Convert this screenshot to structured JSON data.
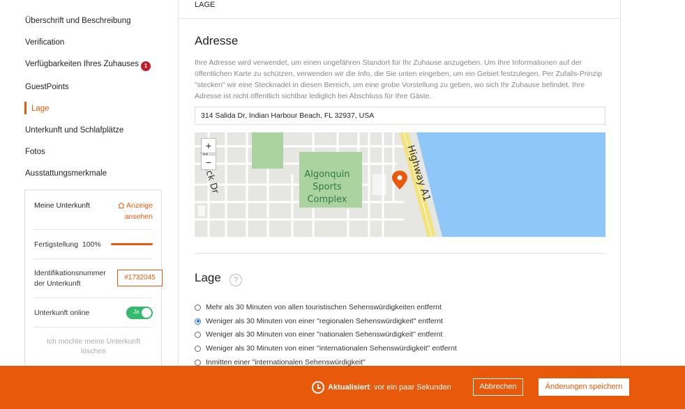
{
  "sidebar": {
    "items": [
      {
        "label": "Überschrift und Beschreibung"
      },
      {
        "label": "Verification"
      },
      {
        "label": "Verfügbarkeiten Ihres Zuhauses",
        "badge": "1"
      },
      {
        "label": "GuestPoints"
      },
      {
        "label": "Lage",
        "active": true
      },
      {
        "label": "Unterkunft und Schlafplätze"
      },
      {
        "label": "Fotos"
      },
      {
        "label": "Ausstattungsmerkmale"
      }
    ]
  },
  "card": {
    "title": "Meine Unterkunft",
    "view_link": "Anzeige ansehen",
    "completion_label": "Fertigstellung",
    "completion_value": "100%",
    "completion_fraction": 1.0,
    "id_label": "Identifikationsnummer der Unterkunft",
    "id_value": "#1732045",
    "online_label": "Unterkunft online",
    "online_toggle": "Ja",
    "delete_label": "Ich möchte meine Unterkunft löschen"
  },
  "main": {
    "section_header": "LAGE",
    "address_title": "Adresse",
    "address_description": "Ihre Adresse wird verwendet, um einen ungefähren Standort für Ihr Zuhause anzugeben. Um Ihre Informationen auf der öffentlichen Karte zu schützen, verwenden wir die Info, die Sie unten eingeben, um ein Gebiet festzulegen. Per Zufalls-Prinzip \"stecken\" wir eine Stecknadel in diesen Bereich, um eine grobe Vorstellung zu geben, wo sich Ihr Zuhause befindet. Ihre Adresse ist nicht öffentlich sichtbar lediglich bei Abschluss für Ihre Gäste.",
    "address_value": "314 Salida Dr, Indian Harbour Beach, FL 32937, USA",
    "map": {
      "zoom_in": "+",
      "zoom_out": "−",
      "labels": {
        "park_line1": "Algonquin",
        "park_line2": "Sports",
        "park_line3": "Complex",
        "road_highway": "Highway A1",
        "road_patrick": "Patrick Dr"
      }
    },
    "lage_title": "Lage",
    "help": "?",
    "options": [
      {
        "label": "Mehr als 30 Minuten von allen touristischen Sehenswürdigkeiten entfernt",
        "checked": false
      },
      {
        "label": "Weniger als 30 Minuten von einer \"regionalen Sehenswürdigkeit\" entfernt",
        "checked": true
      },
      {
        "label": "Weniger als 30 Minuten von einer \"nationalen Sehenswürdigkeit\" entfernt",
        "checked": false
      },
      {
        "label": "Weniger als 30 Minuten von einer \"internationalen Sehenswürdigkeit\" entfernt",
        "checked": false
      },
      {
        "label": "Inmitten einer \"internationalen Sehenswürdigkeit\"",
        "checked": false
      }
    ]
  },
  "footer": {
    "status_bold": "Aktualisiert",
    "status_rest": ": vor ein paar Sekunden",
    "cancel": "Abbrechen",
    "save": "Änderungen speichern"
  },
  "colors": {
    "accent": "#e8590c",
    "badge": "#c51d2a",
    "toggle_on": "#34b96d",
    "water": "#8ec7f8",
    "park": "#aad3a0"
  }
}
